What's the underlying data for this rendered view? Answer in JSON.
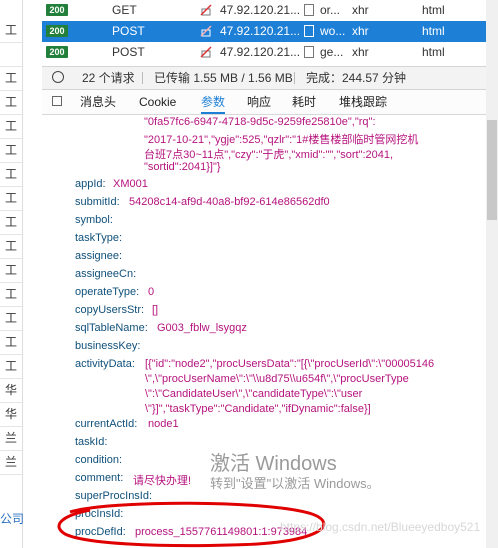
{
  "left_strip": {
    "chars": [
      "工",
      "",
      "工",
      "工",
      "工",
      "工",
      "工",
      "工",
      "工",
      "工",
      "工",
      "工",
      "工",
      "工",
      "工",
      "华",
      "华",
      "兰",
      "兰"
    ],
    "company": "公司"
  },
  "requests": [
    {
      "status": "200",
      "method": "GET",
      "domain": "47.92.120.21...",
      "file": "or...",
      "cause": "xhr",
      "type": "html",
      "selected": false
    },
    {
      "status": "200",
      "method": "POST",
      "domain": "47.92.120.21...",
      "file": "wo...",
      "cause": "xhr",
      "type": "html",
      "selected": true
    },
    {
      "status": "200",
      "method": "POST",
      "domain": "47.92.120.21...",
      "file": "ge...",
      "cause": "xhr",
      "type": "html",
      "selected": false
    }
  ],
  "summary": {
    "requests": "22 个请求",
    "transferred": "已传输 1.55 MB / 1.56 MB",
    "finished": "完成：244.57 分钟"
  },
  "tabs": [
    "消息头",
    "Cookie",
    "参数",
    "响应",
    "耗时",
    "堆栈跟踪"
  ],
  "active_tab": "参数",
  "params": {
    "head_lines": [
      "\"0fa57fc6-6947-4718-9d5c-9259fe25810e\",\"rq\":",
      "\"2017-10-21\",\"ygje\":525,\"qzlr\":\"1#楼售楼部临时管网挖机",
      "台班7点30~11点\",\"czy\":\"于虎\",\"xmid\":\"\",\"sort\":2041,",
      "\"sortid\":2041}]\"}"
    ],
    "appId": "XM001",
    "submitId": "54208c14-af9d-40a8-bf92-614e86562df0",
    "symbol": "",
    "taskType": "",
    "assignee": "",
    "assigneeCn": "",
    "operateType": "0",
    "copyUsersStr": "[]",
    "sqlTableName": "G003_fblw_lsygqz",
    "businessKey": "",
    "activityData_lines": [
      "[{\"id\":\"node2\",\"procUsersData\":\"[{\\\"procUserId\\\":\\\"00005146",
      "\\\",\\\"procUserName\\\":\\\"\\\\u8d75\\\\u654f\\\",\\\"procUserType",
      "\\\":\\\"CandidateUser\\\",\\\"candidateType\\\":\\\"user",
      "\\\"}]\",\"taskType\":\"Candidate\",\"ifDynamic\":false}]"
    ],
    "currentActId": "node1",
    "taskId": "",
    "condition": "",
    "comment": "请尽快办理!",
    "superProcInsId": "",
    "procInsId": "",
    "procDefId": "process_1557761149801:1:973984"
  },
  "param_labels": {
    "appId": "appId:",
    "submitId": "submitId:",
    "symbol": "symbol:",
    "taskType": "taskType:",
    "assignee": "assignee:",
    "assigneeCn": "assigneeCn:",
    "operateType": "operateType:",
    "copyUsersStr": "copyUsersStr:",
    "sqlTableName": "sqlTableName:",
    "businessKey": "businessKey:",
    "activityData": "activityData:",
    "currentActId": "currentActId:",
    "taskId": "taskId:",
    "condition": "condition:",
    "comment": "comment:",
    "superProcInsId": "superProcInsId:",
    "procInsId": "procInsId:",
    "procDefId": "procDefId:"
  },
  "watermark": {
    "line1": "激活 Windows",
    "line2": "转到\"设置\"以激活 Windows。",
    "blog": "https://blog.csdn.net/Blueeyedboy521"
  },
  "colors": {
    "selected_row": "#1e7fd6",
    "status_badge": "#22803a",
    "param_key": "#10507a",
    "param_value": "#b5137d",
    "annotation": "#e00000"
  }
}
